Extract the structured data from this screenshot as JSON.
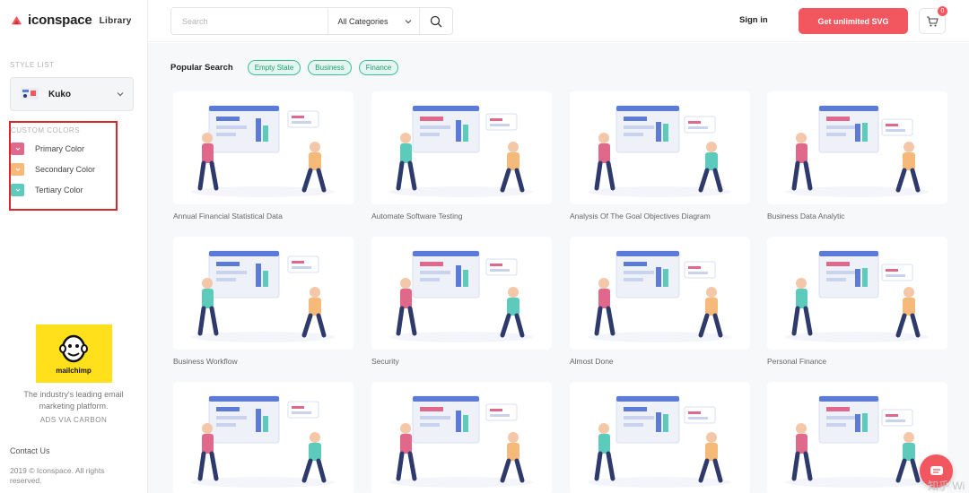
{
  "brand": {
    "name": "iconspace",
    "section": "Library",
    "accent": "#f2565f"
  },
  "sidebar": {
    "style_list_label": "STYLE LIST",
    "selected_style": "Kuko",
    "custom_colors_label": "CUSTOM COLORS",
    "colors": [
      {
        "label": "Primary Color",
        "hex": "#e0688a"
      },
      {
        "label": "Secondary Color",
        "hex": "#f5b97a"
      },
      {
        "label": "Tertiary Color",
        "hex": "#5ccbbb"
      }
    ],
    "ad": {
      "brand": "mailchimp",
      "text": "The industry's leading email marketing platform.",
      "via": "ADS VIA CARBON"
    },
    "contact": "Contact Us",
    "copyright": "2019 © Iconspace. All rights reserved."
  },
  "header": {
    "search_placeholder": "Search",
    "category": "All Categories",
    "signin": "Sign in",
    "cta": "Get unlimited SVG",
    "cart_count": "0"
  },
  "popular": {
    "label": "Popular Search",
    "tags": [
      "Empty State",
      "Business",
      "Finance"
    ]
  },
  "cards": [
    "Annual Financial Statistical Data",
    "Automate Software Testing",
    "Analysis Of The Goal Objectives Diagram",
    "Business Data Analytic",
    "Business Workflow",
    "Security",
    "Almost Done",
    "Personal Finance",
    "",
    "",
    "",
    ""
  ],
  "watermark": "知乎 Wi"
}
